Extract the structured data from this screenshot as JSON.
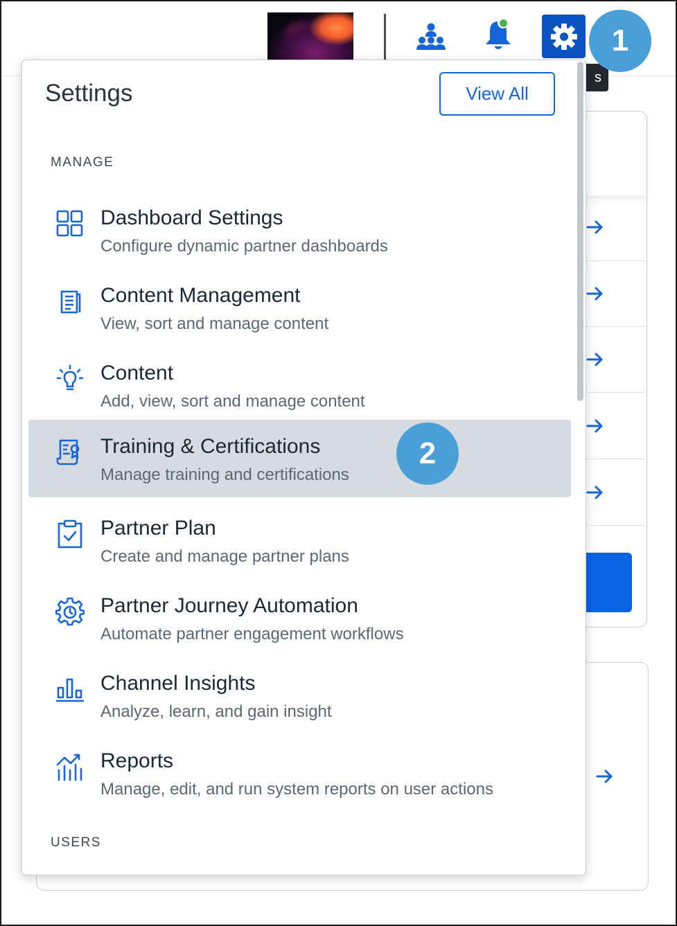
{
  "topbar": {
    "icons": {
      "team": "team-hierarchy-icon",
      "bell": "bell-icon",
      "gear": "gear-icon"
    },
    "tooltip_text": "s"
  },
  "steps": {
    "one": "1",
    "two": "2"
  },
  "settings": {
    "title": "Settings",
    "view_all_label": "View All",
    "sections": {
      "manage": "MANAGE",
      "users": "USERS"
    },
    "items": [
      {
        "icon": "grid-icon",
        "title": "Dashboard Settings",
        "description": "Configure dynamic partner dashboards",
        "active": false
      },
      {
        "icon": "document-icon",
        "title": "Content Management",
        "description": "View, sort and manage content",
        "active": false
      },
      {
        "icon": "lightbulb-icon",
        "title": "Content",
        "description": "Add, view, sort and manage content",
        "active": false
      },
      {
        "icon": "certificate-icon",
        "title": "Training & Certifications",
        "description": "Manage training and certifications",
        "active": true
      },
      {
        "icon": "clipboard-check-icon",
        "title": "Partner Plan",
        "description": "Create and manage partner plans",
        "active": false
      },
      {
        "icon": "gear-automation-icon",
        "title": "Partner Journey Automation",
        "description": "Automate partner engagement workflows",
        "active": false
      },
      {
        "icon": "bar-chart-icon",
        "title": "Channel Insights",
        "description": "Analyze, learn, and gain insight",
        "active": false
      },
      {
        "icon": "report-chart-icon",
        "title": "Reports",
        "description": "Manage, edit, and run system reports on user actions",
        "active": false
      }
    ]
  },
  "colors": {
    "accent": "#1565d8",
    "gear_button": "#0b52c2",
    "step_badge": "#4a9fd8",
    "active_row": "#d6dbe2",
    "notification_dot": "#4caf50"
  }
}
